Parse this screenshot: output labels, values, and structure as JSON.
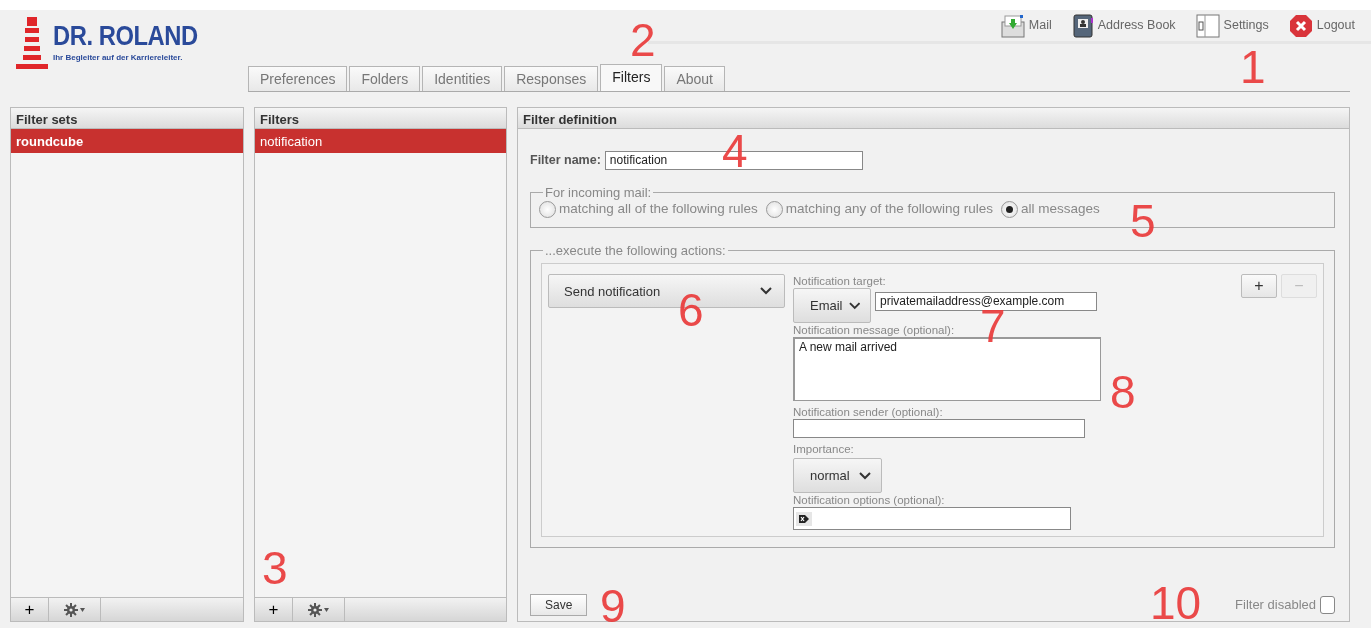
{
  "header": {
    "logo": {
      "title": "DR. ROLAND",
      "tagline": "Ihr Begleiter auf der Karriereleiter."
    },
    "top_nav": [
      {
        "label": "Mail"
      },
      {
        "label": "Address Book"
      },
      {
        "label": "Settings"
      },
      {
        "label": "Logout"
      }
    ]
  },
  "tabs": [
    {
      "label": "Preferences",
      "selected": false
    },
    {
      "label": "Folders",
      "selected": false
    },
    {
      "label": "Identities",
      "selected": false
    },
    {
      "label": "Responses",
      "selected": false
    },
    {
      "label": "Filters",
      "selected": true
    },
    {
      "label": "About",
      "selected": false
    }
  ],
  "filter_sets": {
    "title": "Filter sets",
    "items": [
      {
        "label": "roundcube",
        "selected": true
      }
    ],
    "footer_add": "+"
  },
  "filters": {
    "title": "Filters",
    "items": [
      {
        "label": "notification",
        "selected": true
      }
    ],
    "footer_add": "+"
  },
  "definition": {
    "title": "Filter definition",
    "name_label": "Filter name:",
    "name_value": "notification",
    "incoming": {
      "legend": "For incoming mail:",
      "options": [
        {
          "label": "matching all of the following rules",
          "selected": false
        },
        {
          "label": "matching any of the following rules",
          "selected": false
        },
        {
          "label": "all messages",
          "selected": true
        }
      ]
    },
    "actions": {
      "legend": "...execute the following actions:",
      "action": "Send notification",
      "target_label": "Notification target:",
      "target_method": "Email",
      "target_value": "privatemailaddress@example.com",
      "message_label": "Notification message (optional):",
      "message_value": "A new mail arrived",
      "sender_label": "Notification sender (optional):",
      "importance_label": "Importance:",
      "importance_value": "normal",
      "options_label": "Notification options (optional):",
      "add_label": "+",
      "remove_label": "−",
      "remove_disabled": true
    },
    "save_label": "Save",
    "disabled_label": "Filter disabled",
    "disabled_checked": false
  },
  "callouts": [
    "1",
    "2",
    "3",
    "4",
    "5",
    "6",
    "7",
    "8",
    "9",
    "10"
  ]
}
